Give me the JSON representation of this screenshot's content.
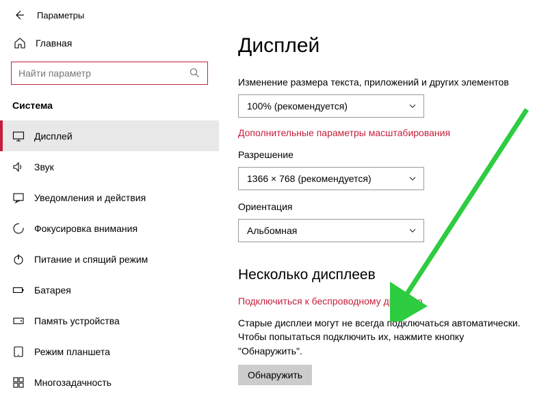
{
  "titlebar": {
    "title": "Параметры"
  },
  "home": {
    "label": "Главная"
  },
  "search": {
    "placeholder": "Найти параметр"
  },
  "section": "Система",
  "nav": [
    {
      "label": "Дисплей",
      "icon": "display"
    },
    {
      "label": "Звук",
      "icon": "sound"
    },
    {
      "label": "Уведомления и действия",
      "icon": "notifications"
    },
    {
      "label": "Фокусировка внимания",
      "icon": "focus"
    },
    {
      "label": "Питание и спящий режим",
      "icon": "power"
    },
    {
      "label": "Батарея",
      "icon": "battery"
    },
    {
      "label": "Память устройства",
      "icon": "storage"
    },
    {
      "label": "Режим планшета",
      "icon": "tablet"
    },
    {
      "label": "Многозадачность",
      "icon": "multitask"
    }
  ],
  "page": {
    "title": "Дисплей",
    "scale_label": "Изменение размера текста, приложений и других элементов",
    "scale_value": "100% (рекомендуется)",
    "scale_link": "Дополнительные параметры масштабирования",
    "resolution_label": "Разрешение",
    "resolution_value": "1366 × 768 (рекомендуется)",
    "orientation_label": "Ориентация",
    "orientation_value": "Альбомная",
    "multi_heading": "Несколько дисплеев",
    "wireless_link": "Подключиться к беспроводному дисплею",
    "detect_desc": "Старые дисплеи могут не всегда подключаться автоматически. Чтобы попытаться подключить их, нажмите кнопку \"Обнаружить\".",
    "detect_btn": "Обнаружить"
  }
}
